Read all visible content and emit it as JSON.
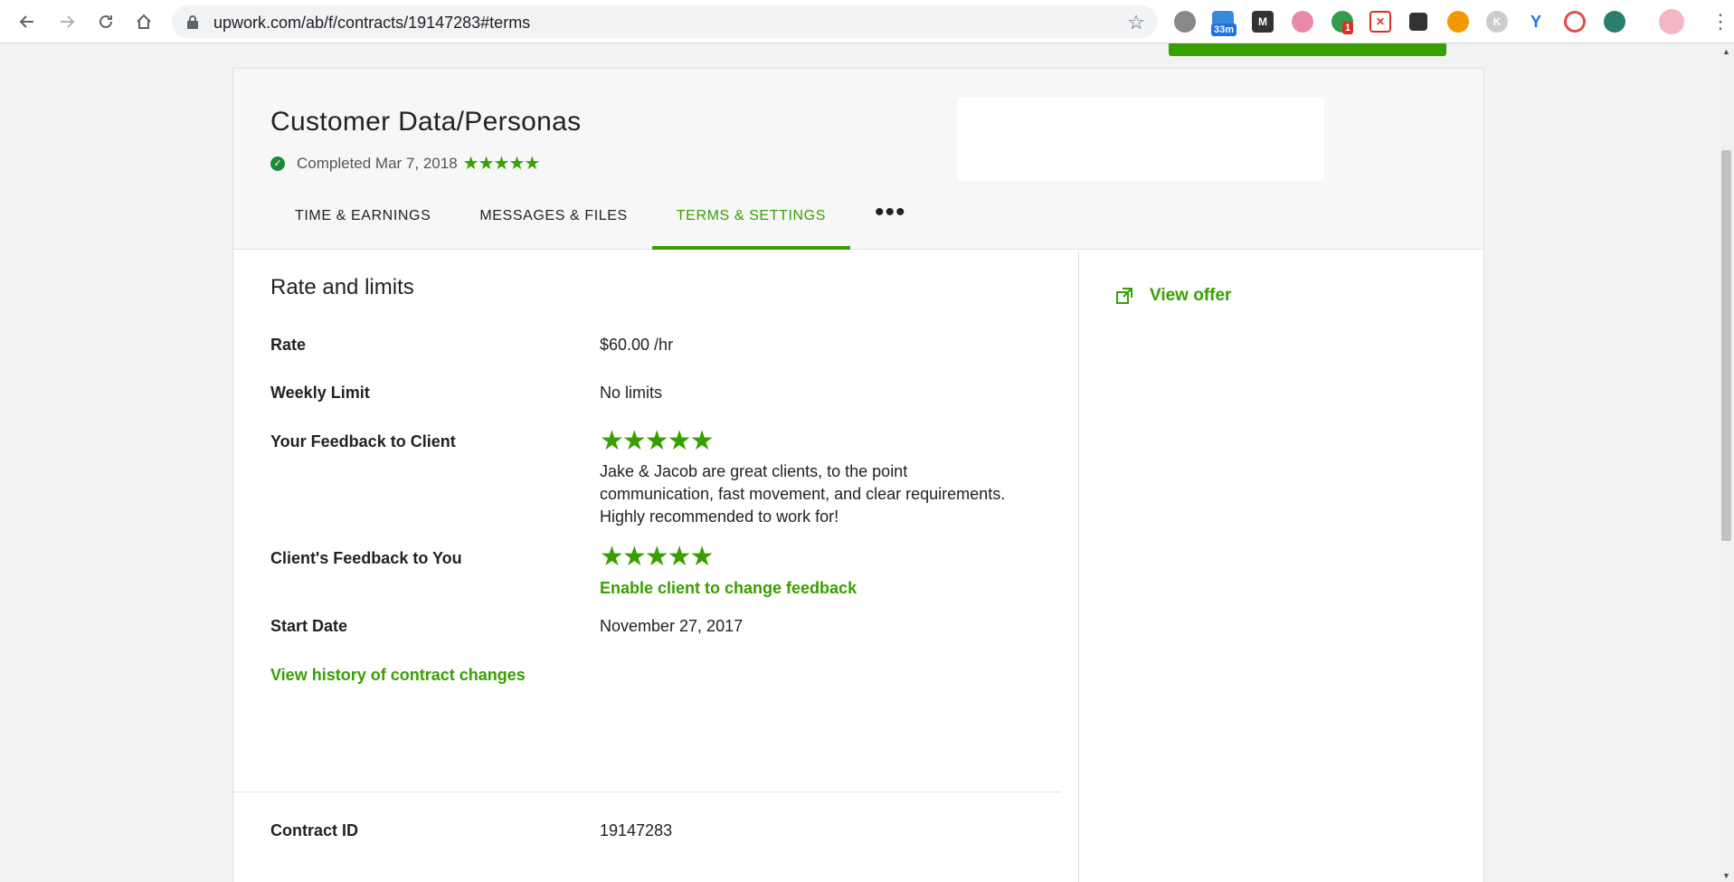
{
  "browser": {
    "url": "upwork.com/ab/f/contracts/19147283#terms",
    "ext_badge_timer": "33m",
    "ext_badge_count": "1",
    "ext_k_letter": "K"
  },
  "contract": {
    "title": "Customer Data/Personas",
    "status": "Completed Mar 7, 2018",
    "rating_stars": 5
  },
  "tabs": [
    {
      "label": "TIME & EARNINGS",
      "active": false
    },
    {
      "label": "MESSAGES & FILES",
      "active": false
    },
    {
      "label": "TERMS & SETTINGS",
      "active": true
    }
  ],
  "tab_more": "•••",
  "section": {
    "title": "Rate and limits",
    "rate_label": "Rate",
    "rate_value": "$60.00 /hr",
    "weekly_limit_label": "Weekly Limit",
    "weekly_limit_value": "No limits",
    "your_feedback_label": "Your Feedback to Client",
    "your_feedback_stars": 5,
    "your_feedback_text": "Jake & Jacob are great clients, to the point communication, fast movement, and clear requirements. Highly recommended to work for!",
    "client_feedback_label": "Client's Feedback to You",
    "client_feedback_stars": 5,
    "enable_change_link": "Enable client to change feedback",
    "start_date_label": "Start Date",
    "start_date_value": "November 27, 2017",
    "history_link": "View history of contract changes",
    "contract_id_label": "Contract ID",
    "contract_id_value": "19147283"
  },
  "sidebar": {
    "view_offer": "View offer"
  },
  "colors": {
    "brand_green": "#37a000",
    "status_check": "#1a8c3c"
  }
}
